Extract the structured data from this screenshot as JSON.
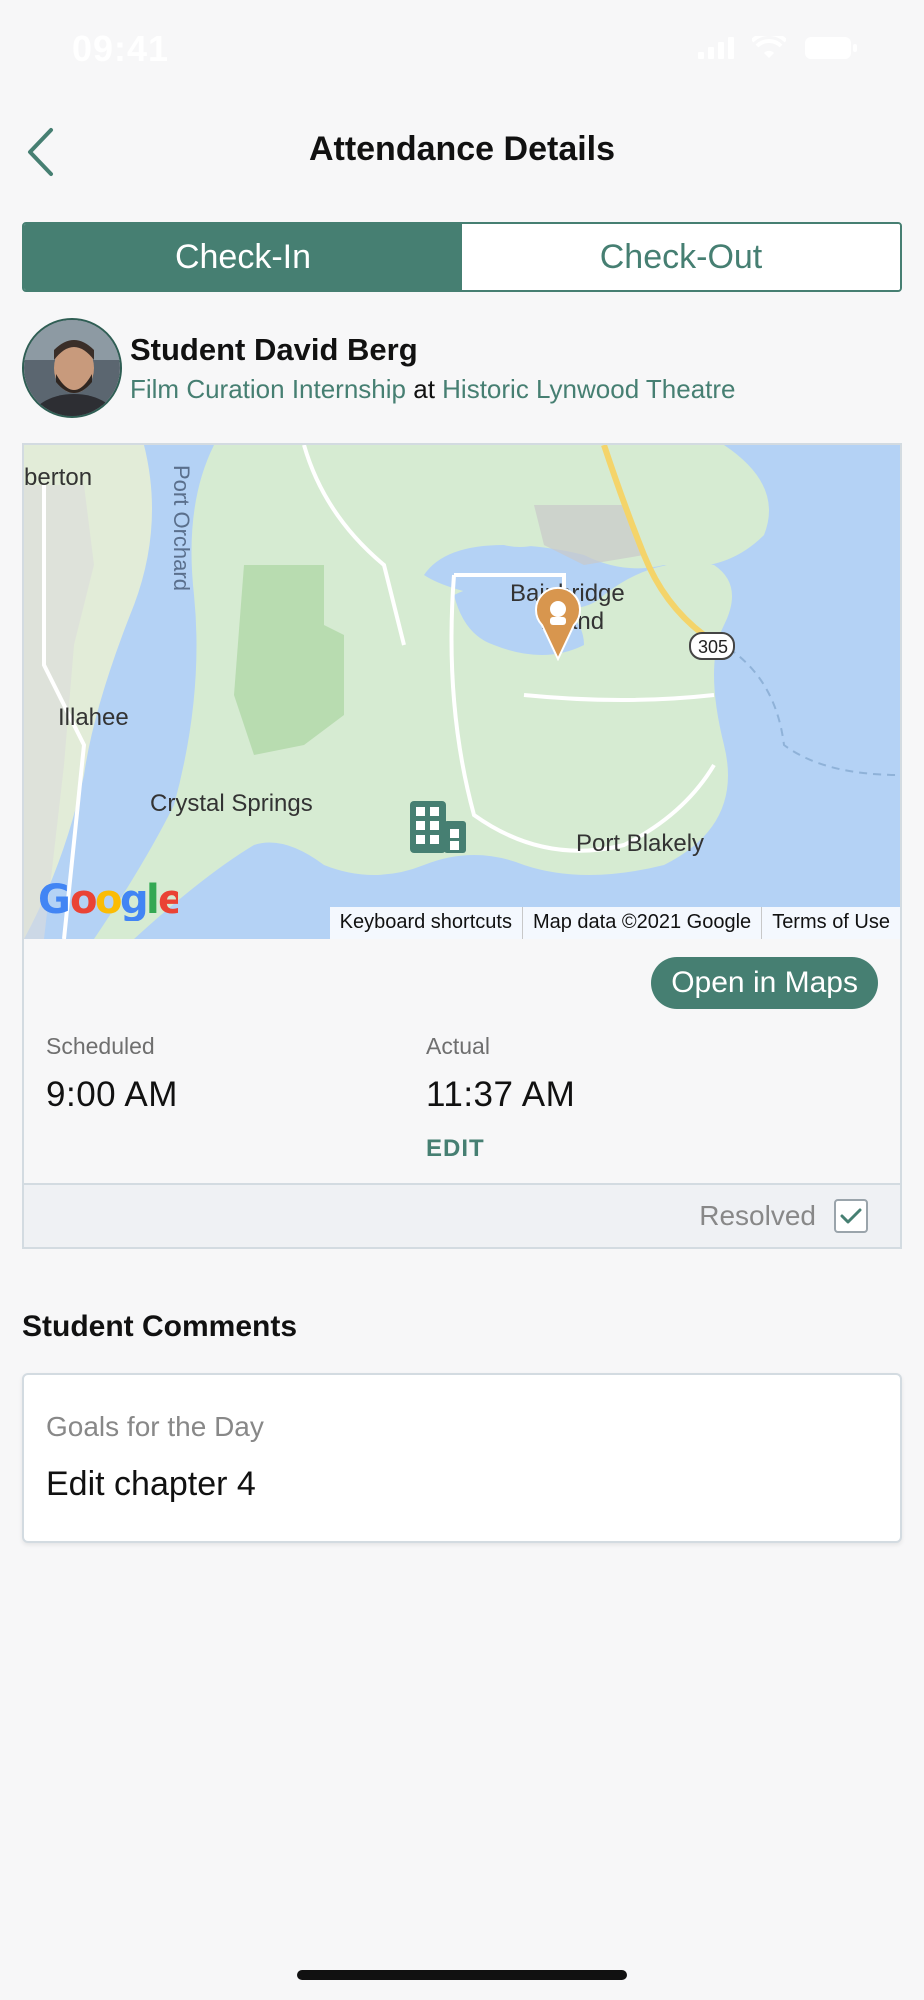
{
  "status_bar": {
    "time": "09:41"
  },
  "nav": {
    "title": "Attendance Details"
  },
  "tabs": [
    {
      "label": "Check-In",
      "active": true
    },
    {
      "label": "Check-Out",
      "active": false
    }
  ],
  "student": {
    "name": "Student David Berg",
    "program": "Film Curation Internship",
    "connector": "at",
    "location": "Historic Lynwood Theatre"
  },
  "map": {
    "labels": {
      "bremerton": "berton",
      "port_orchard": "Port Orchard",
      "illahee": "Illahee",
      "crystal_springs": "Crystal Springs",
      "bainbridge_1": "Bainbridge",
      "bainbridge_2": "Island",
      "port_blakely": "Port Blakely",
      "route": "305"
    },
    "attribution": {
      "shortcuts": "Keyboard shortcuts",
      "data": "Map data ©2021 Google",
      "terms": "Terms of Use"
    },
    "logo": "Google"
  },
  "open_maps_label": "Open in Maps",
  "times": {
    "scheduled_label": "Scheduled",
    "scheduled_value": "9:00 AM",
    "actual_label": "Actual",
    "actual_value": "11:37 AM",
    "edit_label": "EDIT"
  },
  "resolved": {
    "label": "Resolved",
    "checked": true
  },
  "comments": {
    "heading": "Student Comments",
    "label": "Goals for the Day",
    "value": "Edit chapter 4"
  },
  "colors": {
    "accent": "#467f72",
    "marker": "#d8964e"
  }
}
